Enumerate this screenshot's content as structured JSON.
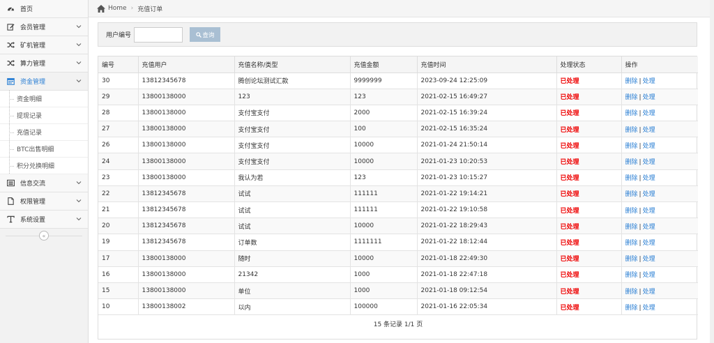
{
  "sidebar": {
    "items": [
      {
        "label": "首页",
        "icon": "dashboard-icon",
        "has_children": false
      },
      {
        "label": "会员管理",
        "icon": "edit-icon",
        "has_children": true
      },
      {
        "label": "矿机管理",
        "icon": "shuffle-icon",
        "has_children": true
      },
      {
        "label": "算力管理",
        "icon": "shuffle-icon",
        "has_children": true
      },
      {
        "label": "资金管理",
        "icon": "calendar-icon",
        "has_children": true,
        "active": true
      },
      {
        "label": "信息交流",
        "icon": "list-icon",
        "has_children": true
      },
      {
        "label": "权限管理",
        "icon": "file-icon",
        "has_children": true
      },
      {
        "label": "系统设置",
        "icon": "text-icon",
        "has_children": true
      }
    ],
    "sub_items": [
      "资金明细",
      "提现记录",
      "充值记录",
      "BTC出售明细",
      "积分兑换明细"
    ]
  },
  "breadcrumb": {
    "home": "Home",
    "current": "充值订单"
  },
  "search": {
    "label": "用户编号",
    "value": "",
    "button": "查询"
  },
  "table": {
    "headers": [
      "编号",
      "充值用户",
      "充值名称/类型",
      "充值金额",
      "充值时间",
      "处理状态",
      "操作"
    ],
    "rows": [
      [
        "30",
        "13812345678",
        "腾创论坛测试汇款",
        "9999999",
        "2023-09-24 12:25:09",
        "已处理"
      ],
      [
        "29",
        "13800138000",
        "123",
        "123",
        "2021-02-15 16:49:27",
        "已处理"
      ],
      [
        "28",
        "13800138000",
        "支付宝支付",
        "2000",
        "2021-02-15 16:39:24",
        "已处理"
      ],
      [
        "27",
        "13800138000",
        "支付宝支付",
        "100",
        "2021-02-15 16:35:24",
        "已处理"
      ],
      [
        "26",
        "13800138000",
        "支付宝支付",
        "10000",
        "2021-01-24 21:50:14",
        "已处理"
      ],
      [
        "24",
        "13800138000",
        "支付宝支付",
        "10000",
        "2021-01-23 10:20:53",
        "已处理"
      ],
      [
        "23",
        "13800138000",
        "我认为若",
        "123",
        "2021-01-23 10:15:27",
        "已处理"
      ],
      [
        "22",
        "13812345678",
        "试试",
        "111111",
        "2021-01-22 19:14:21",
        "已处理"
      ],
      [
        "21",
        "13812345678",
        "试试",
        "111111",
        "2021-01-22 19:10:58",
        "已处理"
      ],
      [
        "20",
        "13812345678",
        "试试",
        "10000",
        "2021-01-22 18:29:43",
        "已处理"
      ],
      [
        "19",
        "13812345678",
        "订单数",
        "1111111",
        "2021-01-22 18:12:44",
        "已处理"
      ],
      [
        "17",
        "13800138000",
        "随时",
        "10000",
        "2021-01-18 22:49:30",
        "已处理"
      ],
      [
        "16",
        "13800138000",
        "21342",
        "1000",
        "2021-01-18 22:47:18",
        "已处理"
      ],
      [
        "15",
        "13800138000",
        "单位",
        "1000",
        "2021-01-18 09:12:54",
        "已处理"
      ],
      [
        "10",
        "13800138002",
        "以内",
        "100000",
        "2021-01-16 22:05:34",
        "已处理"
      ]
    ],
    "actions": {
      "delete": "删除",
      "handle": "处理",
      "separator": "|"
    },
    "footer": "15 条记录 1/1 页"
  },
  "colors": {
    "accent": "#2a7fd4",
    "status": "#ee0000",
    "search_button": "#a9bfd3"
  }
}
